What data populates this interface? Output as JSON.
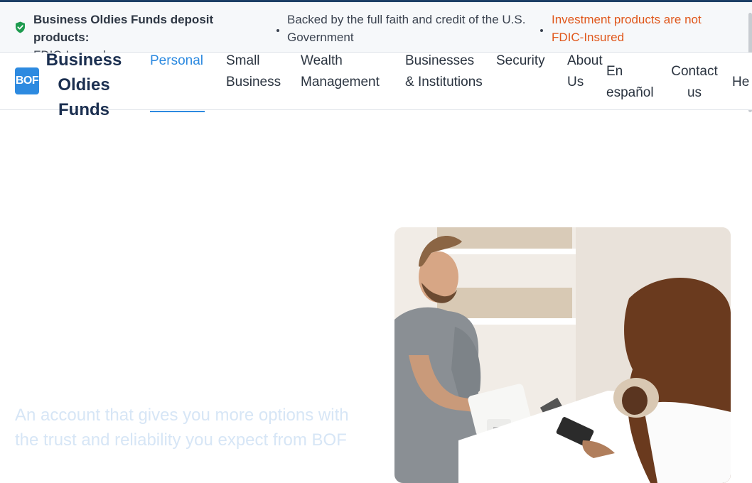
{
  "infobar": {
    "item1_bold": "Business Oldies Funds deposit products:",
    "item1_rest": "FDIC-Insured",
    "item2": "Backed by the full faith and credit of the U.S. Government",
    "item3": "Investment products are not FDIC-Insured",
    "icons": {
      "shield": "shield-check-icon"
    },
    "colors": {
      "shield": "#1e9b4f",
      "warning": "#e0561a"
    }
  },
  "nav": {
    "logo_badge": "BOF",
    "logo_text": "Business Oldies Funds",
    "links": [
      {
        "label": "Personal"
      },
      {
        "label": "Small Business"
      },
      {
        "label": "Wealth Management"
      },
      {
        "label": "Businesses & Institutions"
      },
      {
        "label": "Security"
      },
      {
        "label": "About Us"
      },
      {
        "label": "En español"
      },
      {
        "label": "Contact us"
      },
      {
        "label": "He"
      }
    ],
    "active_color": "#2d8ae0"
  },
  "hero": {
    "tagline": "An account that gives you more options with the trust and reliability you expect from BOF"
  }
}
